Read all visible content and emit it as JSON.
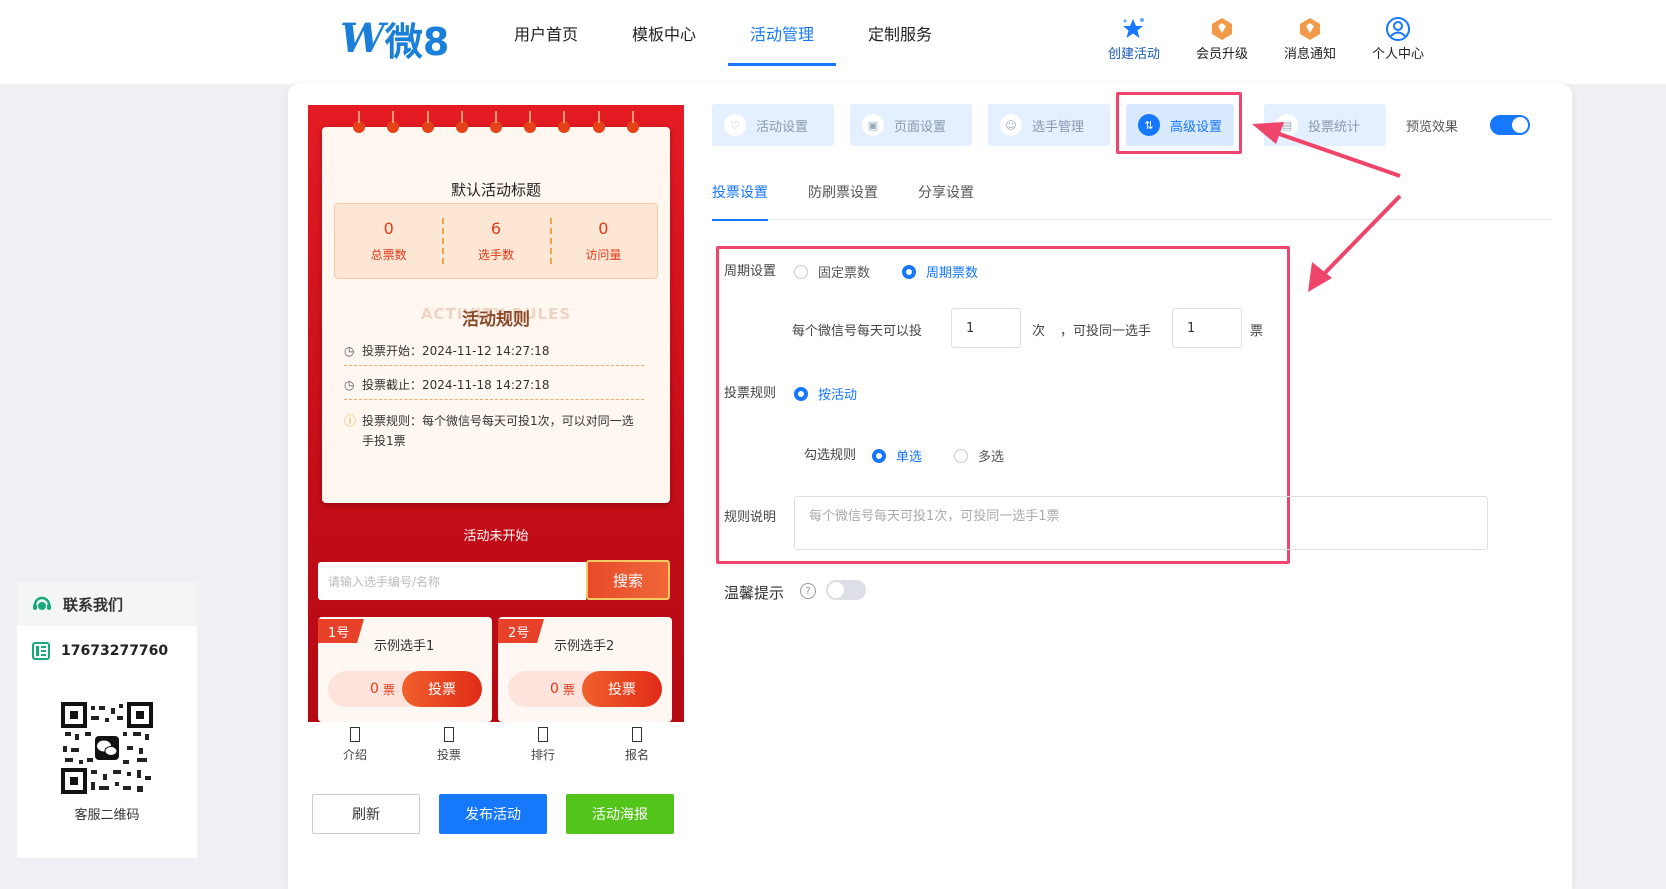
{
  "header": {
    "logo_text": "微8",
    "nav": [
      {
        "label": "用户首页"
      },
      {
        "label": "模板中心"
      },
      {
        "label": "活动管理"
      },
      {
        "label": "定制服务"
      }
    ],
    "tools": [
      {
        "label": "创建活动",
        "icon": "star-sparkle-icon"
      },
      {
        "label": "会员升级",
        "icon": "diamond-badge-icon"
      },
      {
        "label": "消息通知",
        "icon": "bell-badge-icon"
      },
      {
        "label": "个人中心",
        "icon": "user-circle-icon"
      }
    ]
  },
  "contact": {
    "title": "联系我们",
    "phone": "17673277760",
    "qr_label": "客服二维码"
  },
  "preview": {
    "title": "默认活动标题",
    "stats": [
      {
        "value": "0",
        "label": "总票数"
      },
      {
        "value": "6",
        "label": "选手数"
      },
      {
        "value": "0",
        "label": "访问量"
      }
    ],
    "rules_bg": "ACTIVITY RULES",
    "rules_title": "活动规则",
    "vote_start": "投票开始：2024-11-12 14:27:18",
    "vote_end": "投票截止：2024-11-18 14:27:18",
    "vote_rule": "投票规则：每个微信号每天可投1次，可以对同一选手投1票",
    "status": "活动未开始",
    "search_placeholder": "请输入选手编号/名称",
    "search_btn": "搜索",
    "candidates": [
      {
        "tag": "1号",
        "name": "示例选手1",
        "votes": "0",
        "unit": "票",
        "btn": "投票"
      },
      {
        "tag": "2号",
        "name": "示例选手2",
        "votes": "0",
        "unit": "票",
        "btn": "投票"
      }
    ],
    "bottom_tabs": [
      "介绍",
      "投票",
      "排行",
      "报名"
    ]
  },
  "actions": {
    "refresh": "刷新",
    "publish": "发布活动",
    "poster": "活动海报"
  },
  "settings_tabs": [
    {
      "label": "活动设置"
    },
    {
      "label": "页面设置"
    },
    {
      "label": "选手管理"
    },
    {
      "label": "高级设置"
    },
    {
      "label": "投票统计"
    }
  ],
  "preview_toggle": {
    "label": "预览效果",
    "on": true
  },
  "subtabs": [
    "投票设置",
    "防刷票设置",
    "分享设置"
  ],
  "form": {
    "period_label": "周期设置",
    "period_fixed": "固定票数",
    "period_cycle": "周期票数",
    "per_day_label": "每个微信号每天可以投",
    "per_day_value": "1",
    "times_unit": "次",
    "same_label": "，可投同一选手",
    "same_value": "1",
    "ticket_unit": "票",
    "rule_label": "投票规则",
    "rule_by_activity": "按活动",
    "check_label": "勾选规则",
    "check_single": "单选",
    "check_multi": "多选",
    "desc_label": "规则说明",
    "desc_placeholder": "每个微信号每天可投1次，可投同一选手1票",
    "tip_label": "温馨提示",
    "tip_on": false
  },
  "colors": {
    "accent": "#1677ff",
    "highlight": "#f0456a",
    "phone_red": "#e41b23"
  }
}
